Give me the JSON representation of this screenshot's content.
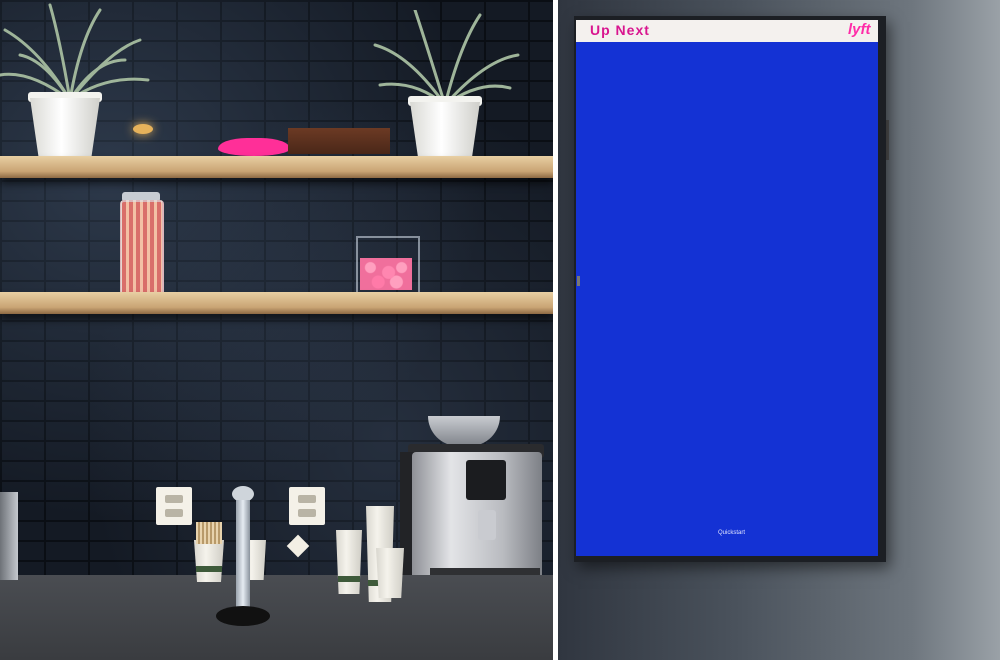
{
  "display": {
    "header_title": "Up Next",
    "brand_logo": "lyft",
    "footer_text": "Quickstart",
    "screen_color": "#1432d4",
    "brand_color": "#ff2ca8"
  },
  "scene": {
    "left": "kitchen-shelf-photo",
    "right": "wall-display-photo"
  }
}
